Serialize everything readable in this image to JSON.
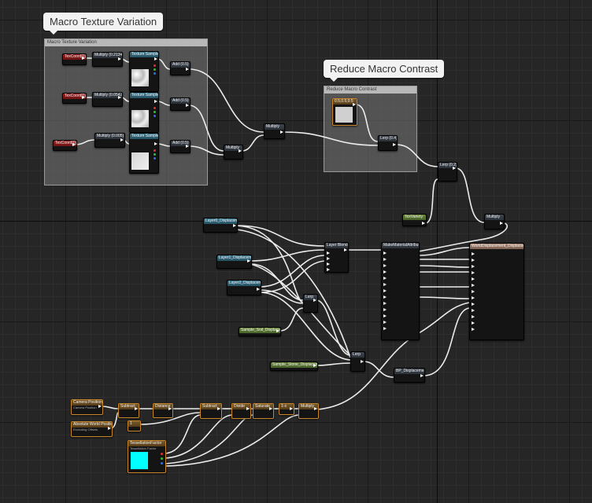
{
  "comments": {
    "macro": {
      "title": "Macro Texture Variation",
      "header": "Macro Texture Variation"
    },
    "reduce": {
      "title": "Reduce Macro Contrast",
      "header": "Reduce Macro Contrast"
    }
  },
  "nodes": {
    "texcoord1": "TexCoord[0]",
    "texcoord2": "TexCoord[0]",
    "texcoord3": "TexCoord[0]",
    "mul1": "Multiply (0.2134)",
    "mul2": "Multiply (0.05425)",
    "mul3": "Multiply (0.005)",
    "texsample1": "Texture Sample",
    "texsample2": "Texture Sample",
    "texsample3": "Texture Sample",
    "add1": "Add (0.5)",
    "add2": "Add (0.5)",
    "add3": "Add (0.5)",
    "mulA": "Multiply",
    "mulB": "Multiply",
    "const3": "0.5,0.5,0.5",
    "lerpR": "Lerp (0.4)",
    "lerpTop": "Lerp (0.2)",
    "texvariety": "TexVariety",
    "mulRight": "Multiply",
    "layer0": "Layer0_Displacement",
    "layer1": "Layer1_Displacement",
    "layer2": "Layer2_Displacement",
    "layerblend": "Layer Blend",
    "lerpMid": "Lerp",
    "sampleSoil": "Sample_Soil_Displacement",
    "sampleStone": "Sample_Stone_Displacement",
    "lerpLow": "Lerp",
    "makeattr": "MakeMaterialAttributes",
    "output": "WorldDisplacement_Displacement",
    "bpdisp": "BP_Displacement",
    "campos": "Camera Position",
    "camposSub": "Camera Position",
    "absworld": "Absolute World Position",
    "absworldSub": "Excluding Offsets",
    "subtract1": "Subtract",
    "length": "Distance",
    "one": "1",
    "subtract2": "Subtract",
    "divide": "Divide",
    "saturate": "Saturate",
    "oneminus": "1-x",
    "mulEnd": "Multiply",
    "vector": "TessellationFactor",
    "vectorSub": "Tessellation Factor"
  },
  "colors": {
    "accent_gold": "#c8862a",
    "vector_cyan": "#00ffff"
  }
}
